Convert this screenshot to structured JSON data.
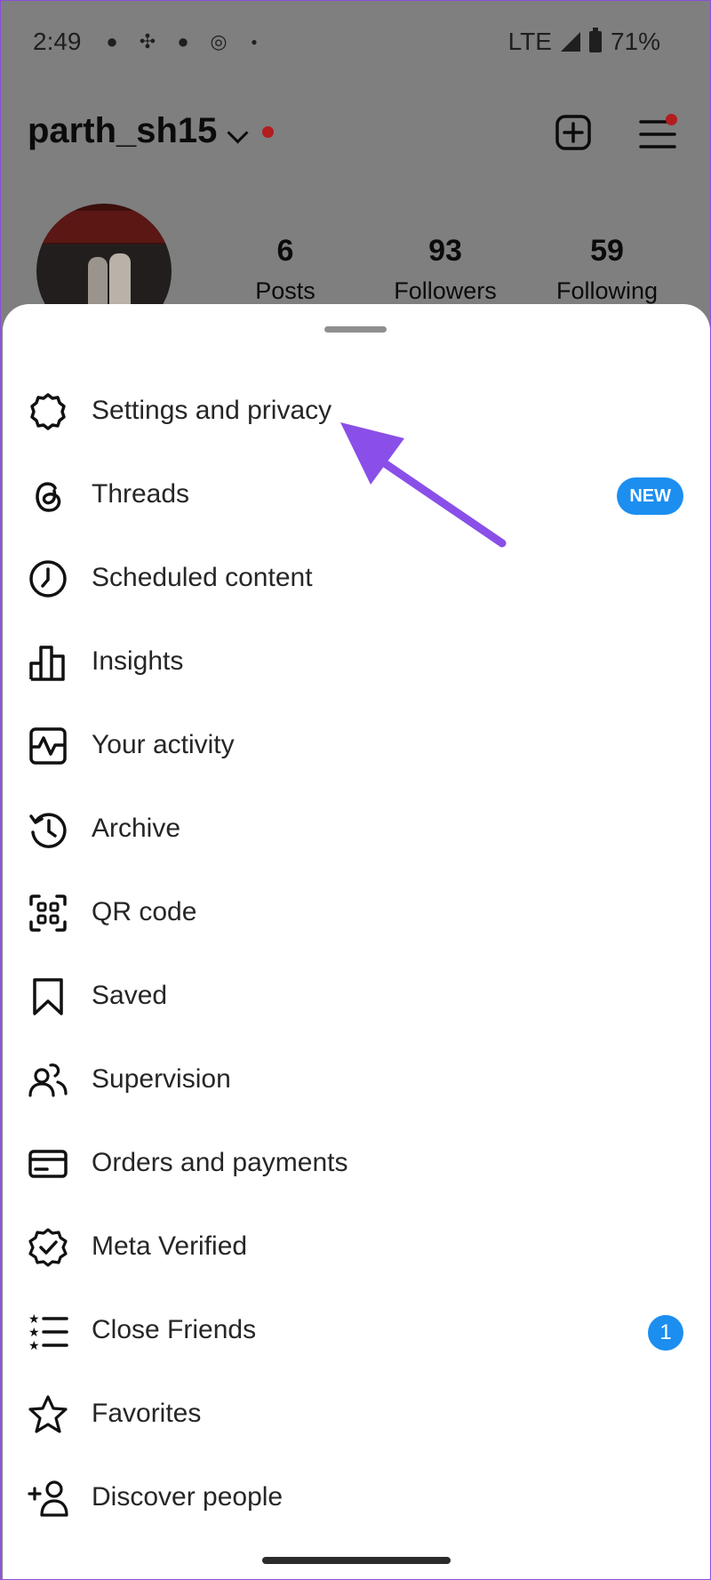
{
  "status_bar": {
    "time": "2:49",
    "network": "LTE",
    "battery": "71%"
  },
  "profile": {
    "username": "parth_sh15",
    "stats": [
      {
        "value": "6",
        "label": "Posts"
      },
      {
        "value": "93",
        "label": "Followers"
      },
      {
        "value": "59",
        "label": "Following"
      }
    ]
  },
  "menu": {
    "items": [
      {
        "label": "Settings and privacy",
        "icon": "settings-gear-icon"
      },
      {
        "label": "Threads",
        "icon": "threads-icon",
        "badge": "NEW"
      },
      {
        "label": "Scheduled content",
        "icon": "clock-icon"
      },
      {
        "label": "Insights",
        "icon": "bar-chart-icon"
      },
      {
        "label": "Your activity",
        "icon": "activity-icon"
      },
      {
        "label": "Archive",
        "icon": "archive-history-icon"
      },
      {
        "label": "QR code",
        "icon": "qr-code-icon"
      },
      {
        "label": "Saved",
        "icon": "bookmark-icon"
      },
      {
        "label": "Supervision",
        "icon": "supervision-people-icon"
      },
      {
        "label": "Orders and payments",
        "icon": "credit-card-icon"
      },
      {
        "label": "Meta Verified",
        "icon": "verified-badge-icon"
      },
      {
        "label": "Close Friends",
        "icon": "close-friends-list-icon",
        "badge": "1"
      },
      {
        "label": "Favorites",
        "icon": "star-icon"
      },
      {
        "label": "Discover people",
        "icon": "add-person-icon"
      }
    ]
  },
  "colors": {
    "accent_blue": "#1c8ef0",
    "notification_red": "#b31d1d",
    "annotation_arrow": "#8a4fe8",
    "overlay_gray": "#7f7f7f"
  }
}
